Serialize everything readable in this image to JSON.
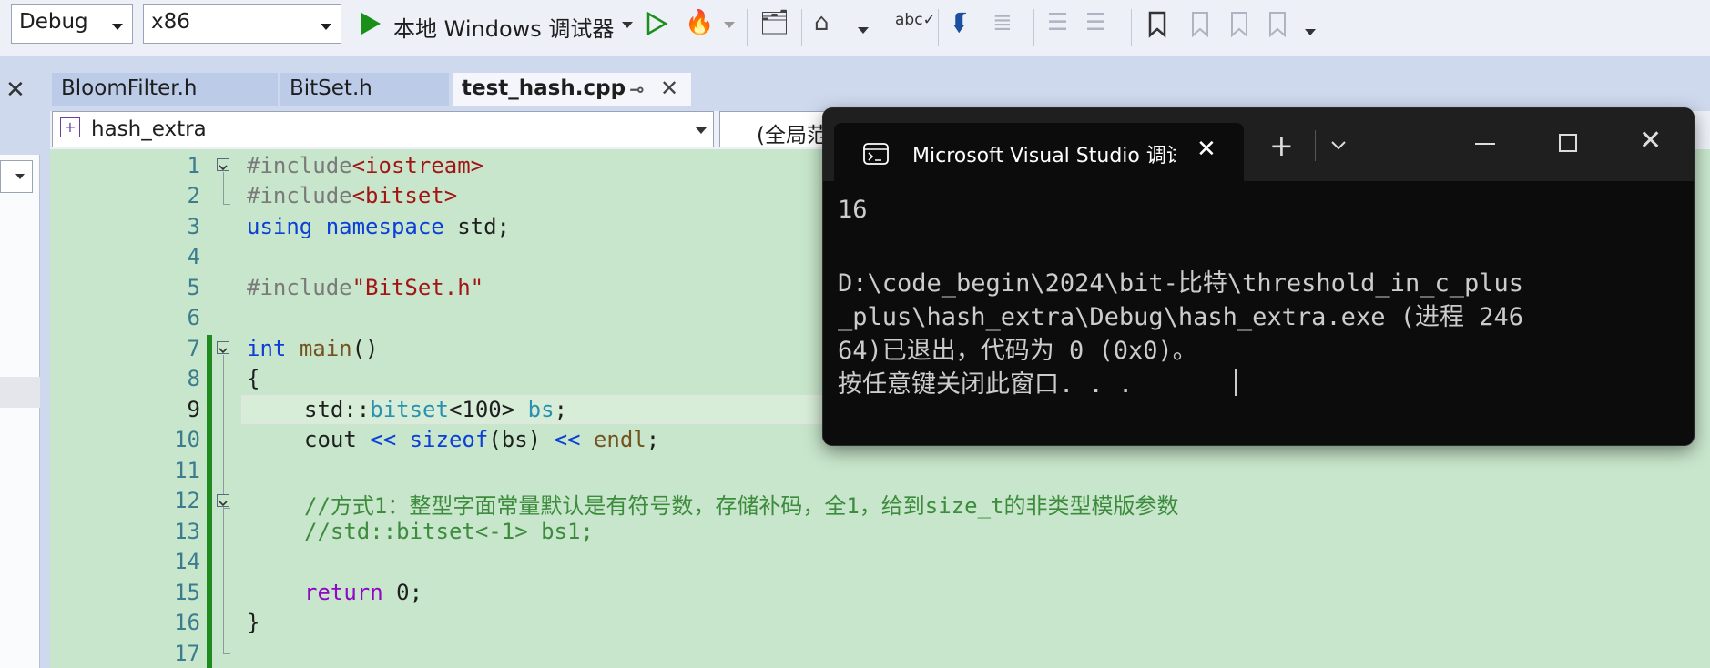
{
  "toolbar": {
    "config_value": "Debug",
    "platform_value": "x86",
    "debug_target": "本地 Windows 调试器"
  },
  "tabs": [
    {
      "label": "BloomFilter.h"
    },
    {
      "label": "BitSet.h"
    },
    {
      "label": "test_hash.cpp"
    }
  ],
  "nav": {
    "project": "hash_extra",
    "scope": "(全局范"
  },
  "editor": {
    "line_numbers": [
      "1",
      "2",
      "3",
      "4",
      "5",
      "6",
      "7",
      "8",
      "9",
      "10",
      "11",
      "12",
      "13",
      "14",
      "15",
      "16",
      "17"
    ],
    "current_line": "9"
  },
  "code": {
    "l1_directive": "#include",
    "l1_header": "<iostream>",
    "l2_directive": "#include",
    "l2_header": "<bitset>",
    "l3_using": "using",
    "l3_namespace": "namespace",
    "l3_rest": " std;",
    "l5_directive": "#include",
    "l5_header": "\"BitSet.h\"",
    "l7_int": "int",
    "l7_main": "main",
    "l7_paren": "()",
    "l8": "{",
    "l9_std": "std::",
    "l9_bitset": "bitset",
    "l9_tpl": "<100> ",
    "l9_bs": "bs",
    "l9_end": ";",
    "l10_cout": "cout ",
    "l10_op1": "<<",
    "l10_sp": " ",
    "l10_sizeof": "sizeof",
    "l10_arg": "(bs) ",
    "l10_op2": "<<",
    "l10_sp2": " ",
    "l10_endl": "endl",
    "l10_end": ";",
    "l12_comment": "//方式1：整型字面常量默认是有符号数，存储补码，全1，给到size_t的非类型模版参数",
    "l13_comment": "//std::bitset<-1> bs1;",
    "l15_return": "return",
    "l15_rest": " 0;",
    "l16": "}"
  },
  "console": {
    "title": "Microsoft Visual Studio 调试控制台",
    "lines": [
      "16",
      "",
      "D:\\code_begin\\2024\\bit-比特\\threshold_in_c_plus",
      "_plus\\hash_extra\\Debug\\hash_extra.exe (进程 246",
      "64)已退出，代码为 0 (0x0)。",
      "按任意键关闭此窗口. . ."
    ]
  },
  "colors": {
    "editor_bg": "#c8e6cb",
    "console_bg": "#0c0c0c",
    "keyword": "#0b3fd6",
    "comment": "#3d8c3d"
  }
}
